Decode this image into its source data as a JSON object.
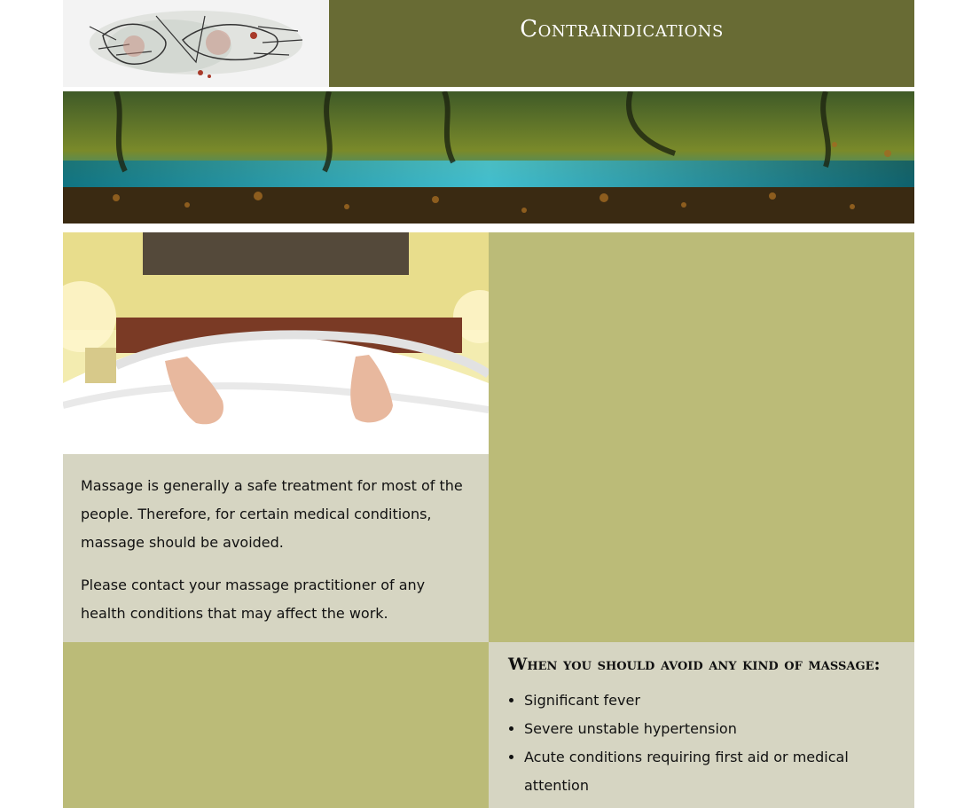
{
  "header": {
    "title": "Contraindications",
    "logo_icon": "hands-massage-illustration"
  },
  "banner": {
    "image": "forest-river-banner"
  },
  "intro": {
    "image": "feet-in-bed-photo",
    "paragraphs": [
      "Massage is generally a safe treatment for most of the people. Therefore, for certain medical conditions, massage should be avoided.",
      "Please contact your massage practitioner of any health conditions that may affect the work."
    ]
  },
  "avoid": {
    "heading": "When you should avoid any kind of massage:",
    "items": [
      "Significant fever",
      "Severe unstable hypertension",
      "Acute conditions requiring first aid or medical attention"
    ]
  },
  "colors": {
    "olive_dark": "#686b34",
    "olive_light": "#bbbb78",
    "beige": "#d6d5c2"
  }
}
